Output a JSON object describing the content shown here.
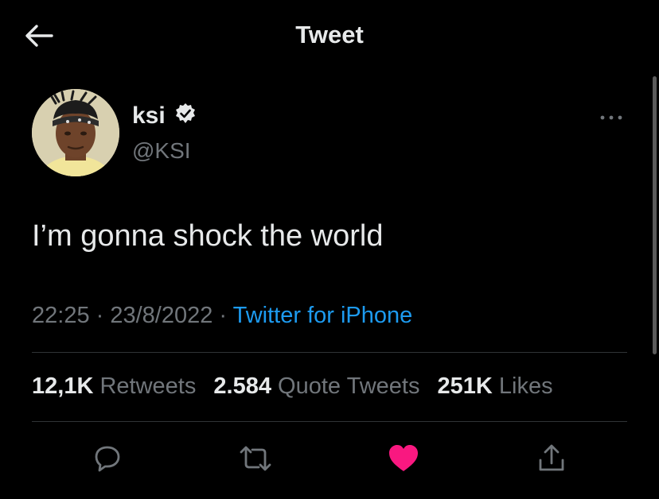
{
  "header": {
    "title": "Tweet",
    "back_icon": "arrow-left-icon"
  },
  "author": {
    "display_name": "ksi",
    "handle": "@KSI",
    "verified_icon": "verified-badge-icon",
    "avatar_icon": "user-avatar"
  },
  "tweet": {
    "text": "I’m gonna shock the world",
    "time": "22:25",
    "separator": " · ",
    "date": "23/8/2022",
    "source": "Twitter for iPhone"
  },
  "stats": {
    "retweets_count": "12,1K",
    "retweets_label": "Retweets",
    "quotes_count": "2.584",
    "quotes_label": "Quote Tweets",
    "likes_count": "251K",
    "likes_label": "Likes"
  },
  "actions": {
    "reply_icon": "reply-icon",
    "retweet_icon": "retweet-icon",
    "like_icon": "heart-icon",
    "share_icon": "share-icon"
  },
  "colors": {
    "background": "#000000",
    "text": "#e7e9ea",
    "secondary": "#71767b",
    "link": "#1d9bf0",
    "like": "#f91880"
  }
}
